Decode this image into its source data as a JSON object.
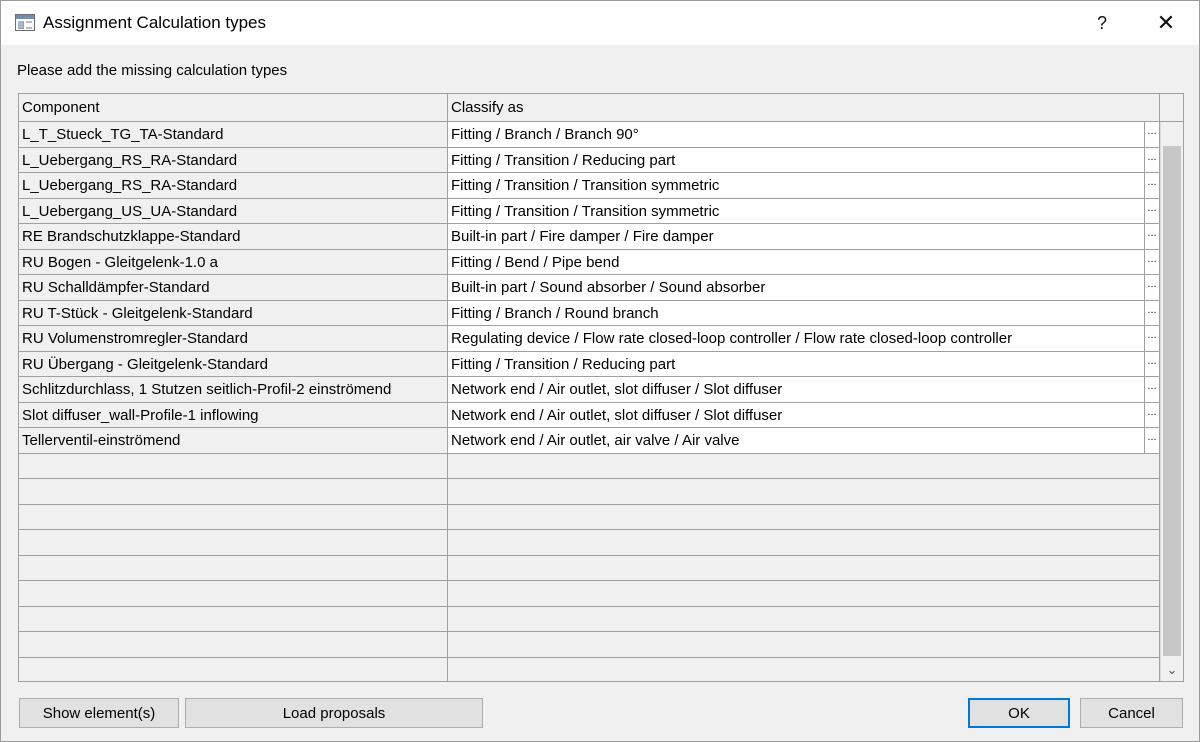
{
  "window": {
    "title": "Assignment Calculation types",
    "help_label": "?",
    "close_label": "✕"
  },
  "instruction": "Please add the missing calculation types",
  "grid": {
    "columns": [
      "Component",
      "Classify as"
    ],
    "ellipsis": "...",
    "rows": [
      {
        "component": "L_T_Stueck_TG_TA-Standard",
        "classify": "Fitting / Branch / Branch 90°"
      },
      {
        "component": "L_Uebergang_RS_RA-Standard",
        "classify": "Fitting / Transition / Reducing part"
      },
      {
        "component": "L_Uebergang_RS_RA-Standard",
        "classify": "Fitting / Transition / Transition symmetric"
      },
      {
        "component": "L_Uebergang_US_UA-Standard",
        "classify": "Fitting / Transition / Transition symmetric"
      },
      {
        "component": "RE Brandschutzklappe-Standard",
        "classify": "Built-in part / Fire damper / Fire damper"
      },
      {
        "component": "RU Bogen - Gleitgelenk-1.0 a",
        "classify": "Fitting / Bend / Pipe bend"
      },
      {
        "component": "RU Schalldämpfer-Standard",
        "classify": "Built-in part / Sound absorber / Sound absorber"
      },
      {
        "component": "RU T-Stück - Gleitgelenk-Standard",
        "classify": "Fitting / Branch / Round branch"
      },
      {
        "component": "RU Volumenstromregler-Standard",
        "classify": "Regulating device / Flow rate closed-loop controller / Flow rate closed-loop controller"
      },
      {
        "component": "RU Übergang - Gleitgelenk-Standard",
        "classify": "Fitting / Transition / Reducing part"
      },
      {
        "component": "Schlitzdurchlass, 1 Stutzen seitlich-Profil-2 einströmend",
        "classify": "Network end / Air outlet, slot diffuser / Slot diffuser"
      },
      {
        "component": "Slot diffuser_wall-Profile-1 inflowing",
        "classify": "Network end / Air outlet, slot diffuser / Slot diffuser"
      },
      {
        "component": "Tellerventil-einströmend",
        "classify": "Network end / Air outlet, air valve / Air valve"
      }
    ],
    "empty_rows": 9
  },
  "buttons": {
    "show": "Show element(s)",
    "load": "Load proposals",
    "ok": "OK",
    "cancel": "Cancel"
  },
  "icons": {
    "scroll_up": "chevron-up-icon",
    "scroll_down": "chevron-down-icon"
  }
}
